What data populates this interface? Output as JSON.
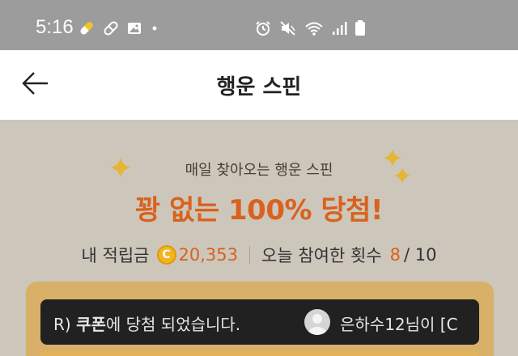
{
  "status_bar": {
    "time": "5:16",
    "left_icons": [
      "pill-icon",
      "bandage-icon",
      "image-icon",
      "dot-icon"
    ],
    "right_icons": [
      "alarm-icon",
      "mute-icon",
      "wifi-icon",
      "signal-icon",
      "battery-icon"
    ]
  },
  "header": {
    "title": "행운 스핀",
    "back_icon": "arrow-left-icon"
  },
  "main": {
    "subtitle": "매일 찾아오는 행운 스핀",
    "headline": "꽝 없는 100% 당첨!",
    "stats": {
      "points_label": "내 적립금",
      "coin_symbol": "C",
      "points_value": "20,353",
      "participation_label": "오늘 참여한 횟수",
      "participation_count": "8",
      "participation_total": "/ 10"
    },
    "notice": {
      "prefix": "R) ",
      "bold_part": "쿠폰",
      "rest": "에 당첨 되었습니다.",
      "user_text": "은하수12님이 [C"
    }
  },
  "colors": {
    "status_bar_bg": "#9c9c9c",
    "main_bg": "#cdc6bb",
    "accent_orange": "#d8621e",
    "card_gold": "#d8b067",
    "notice_bg": "#212121",
    "coin_gold": "#f3b51f"
  }
}
